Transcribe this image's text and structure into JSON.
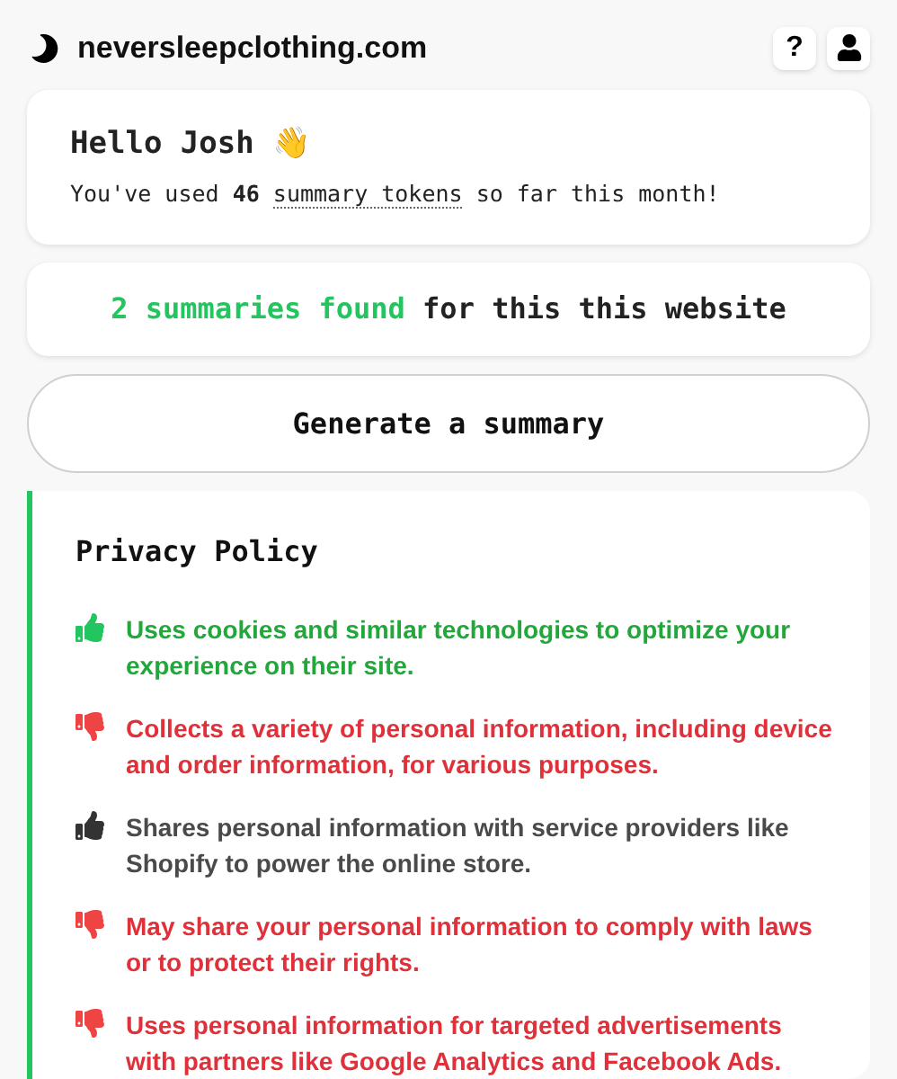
{
  "header": {
    "site": "neversleepclothing.com",
    "help": "?"
  },
  "greeting": {
    "title": "Hello Josh 👋",
    "usage_before": "You've used",
    "count": "46",
    "link": "summary tokens",
    "usage_after": "so far this month!"
  },
  "found": {
    "highlight": "2 summaries found",
    "rest": "for this this website"
  },
  "generate_button": "Generate a summary",
  "summary": {
    "title": "Privacy Policy",
    "items": [
      {
        "kind": "positive",
        "text": "Uses cookies and similar technologies to optimize your experience on their site."
      },
      {
        "kind": "negative",
        "text": "Collects a variety of personal information, including device and order information, for various purposes."
      },
      {
        "kind": "neutral",
        "text": "Shares personal information with service providers like Shopify to power the online store."
      },
      {
        "kind": "negative",
        "text": "May share your personal information to comply with laws or to protect their rights."
      },
      {
        "kind": "negative",
        "text": "Uses personal information for targeted advertisements with partners like Google Analytics and Facebook Ads."
      }
    ]
  }
}
